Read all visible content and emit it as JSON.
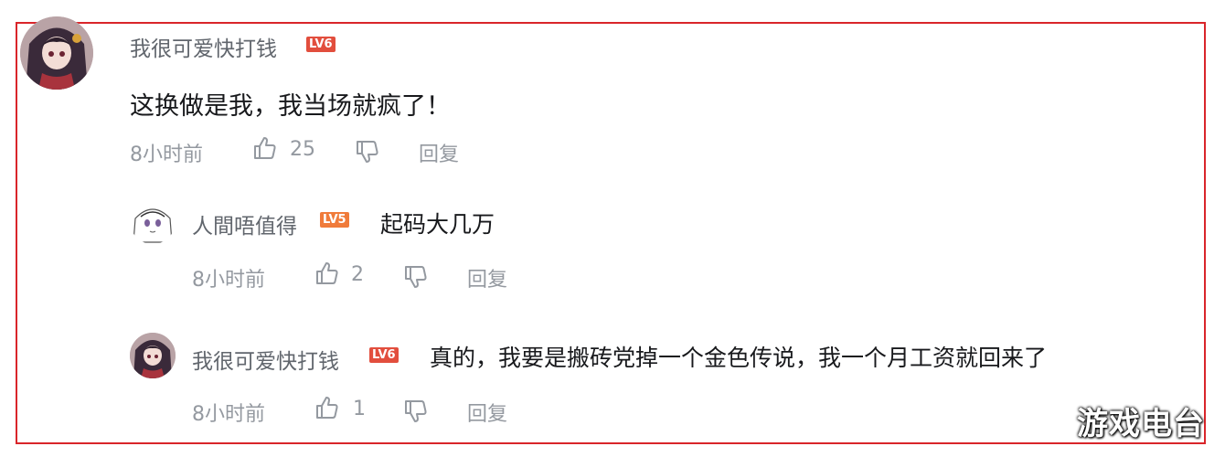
{
  "comment": {
    "username": "我很可爱快打钱",
    "level": "LV6",
    "text": "这换做是我，我当场就疯了！",
    "time": "8小时前",
    "likes": "25",
    "reply_label": "回复"
  },
  "replies": [
    {
      "username": "人間唔值得",
      "level": "LV5",
      "text": "起码大几万",
      "time": "8小时前",
      "likes": "2",
      "reply_label": "回复"
    },
    {
      "username": "我很可爱快打钱",
      "level": "LV6",
      "text": "真的，我要是搬砖党掉一个金色传说，我一个月工资就回来了",
      "time": "8小时前",
      "likes": "1",
      "reply_label": "回复"
    }
  ],
  "watermark": "游戏电台",
  "colors": {
    "highlight_border": "#d9252a",
    "lv6": "#e24e3d",
    "lv5": "#f07b3a",
    "meta": "#9499a0"
  },
  "icons": [
    "thumbs-up-icon",
    "thumbs-down-icon"
  ]
}
